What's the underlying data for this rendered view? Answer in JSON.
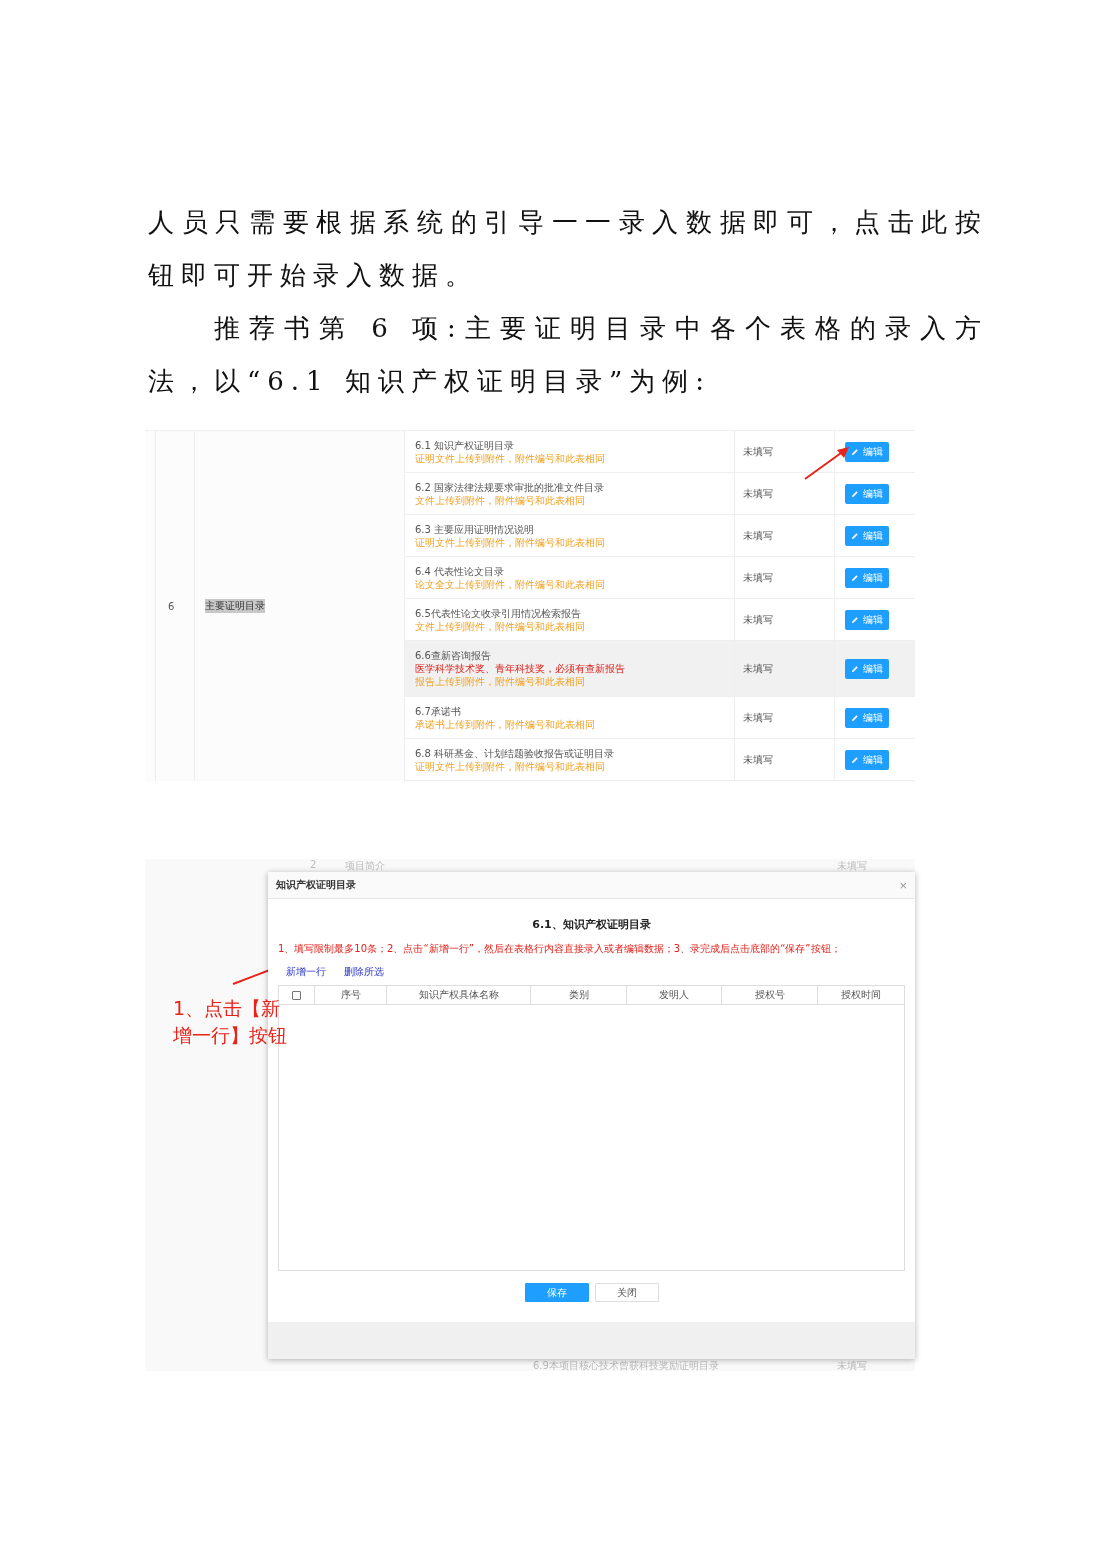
{
  "paragraphs": [
    {
      "text": "人员只需要根据系统的引导一一录入数据即可，点击此按钮即可开始录入数据。",
      "indent": false
    },
    {
      "text": "推荐书第 6 项:主要证明目录中各个表格的录入方法，以“6.1 知识产权证明目录”为例:",
      "indent": true
    }
  ],
  "list_screenshot": {
    "group_index": "6",
    "group_name": "主要证明目录",
    "group_name_selected": true,
    "rows": [
      {
        "title": "6.1 知识产权证明目录",
        "notes": [
          {
            "kind": "hint",
            "text": "证明文件上传到附件，附件编号和此表相同"
          }
        ],
        "status": "未填写",
        "button": "编辑",
        "highlighted": false,
        "arrow": true
      },
      {
        "title": "6.2 国家法律法规要求审批的批准文件目录",
        "notes": [
          {
            "kind": "hint",
            "text": "文件上传到附件，附件编号和此表相同"
          }
        ],
        "status": "未填写",
        "button": "编辑",
        "highlighted": false,
        "arrow": false
      },
      {
        "title": "6.3 主要应用证明情况说明",
        "notes": [
          {
            "kind": "hint",
            "text": "证明文件上传到附件，附件编号和此表相同"
          }
        ],
        "status": "未填写",
        "button": "编辑",
        "highlighted": false,
        "arrow": false
      },
      {
        "title": "6.4 代表性论文目录",
        "notes": [
          {
            "kind": "hint",
            "text": "论文全文上传到附件，附件编号和此表相同"
          }
        ],
        "status": "未填写",
        "button": "编辑",
        "highlighted": false,
        "arrow": false
      },
      {
        "title": "6.5代表性论文收录引用情况检索报告",
        "notes": [
          {
            "kind": "hint",
            "text": "文件上传到附件，附件编号和此表相同"
          }
        ],
        "status": "未填写",
        "button": "编辑",
        "highlighted": false,
        "arrow": false
      },
      {
        "title": "6.6查新咨询报告",
        "notes": [
          {
            "kind": "warning",
            "text": "医学科学技术奖、青年科技奖，必须有查新报告"
          },
          {
            "kind": "hint",
            "text": "报告上传到附件，附件编号和此表相同"
          }
        ],
        "status": "未填写",
        "button": "编辑",
        "highlighted": true,
        "arrow": false
      },
      {
        "title": "6.7承诺书",
        "notes": [
          {
            "kind": "hint",
            "text": "承诺书上传到附件，附件编号和此表相同"
          }
        ],
        "status": "未填写",
        "button": "编辑",
        "highlighted": false,
        "arrow": false
      },
      {
        "title": "6.8 科研基金、计划结题验收报告或证明目录",
        "notes": [
          {
            "kind": "hint",
            "text": "证明文件上传到附件，附件编号和此表相同"
          }
        ],
        "status": "未填写",
        "button": "编辑",
        "highlighted": false,
        "arrow": false
      }
    ]
  },
  "dialog_screenshot": {
    "background_top_row": [
      "2",
      "项目简介",
      "未填写"
    ],
    "background_bottom_row": [
      "6.9本项目核心技术曾获科技奖励证明目录",
      "未填写"
    ],
    "dialog": {
      "title": "知识产权证明目录",
      "close": "×",
      "heading": "6.1、知识产权证明目录",
      "instructions": "1、填写限制最多10条；2、点击“新增一行”，然后在表格行内容直接录入或者编辑数据；3、录完成后点击底部的“保存”按钮；",
      "links": [
        "新增一行",
        "删除所选"
      ],
      "table": {
        "select_all": {
          "checked": false
        },
        "columns": [
          "序号",
          "知识产权具体名称",
          "类别",
          "发明人",
          "授权号",
          "授权时间"
        ]
      },
      "buttons": [
        {
          "kind": "primary",
          "label": "保存"
        },
        {
          "kind": "default",
          "label": "关闭"
        }
      ]
    },
    "annotation": "1、点击【新增一行】按钮"
  }
}
